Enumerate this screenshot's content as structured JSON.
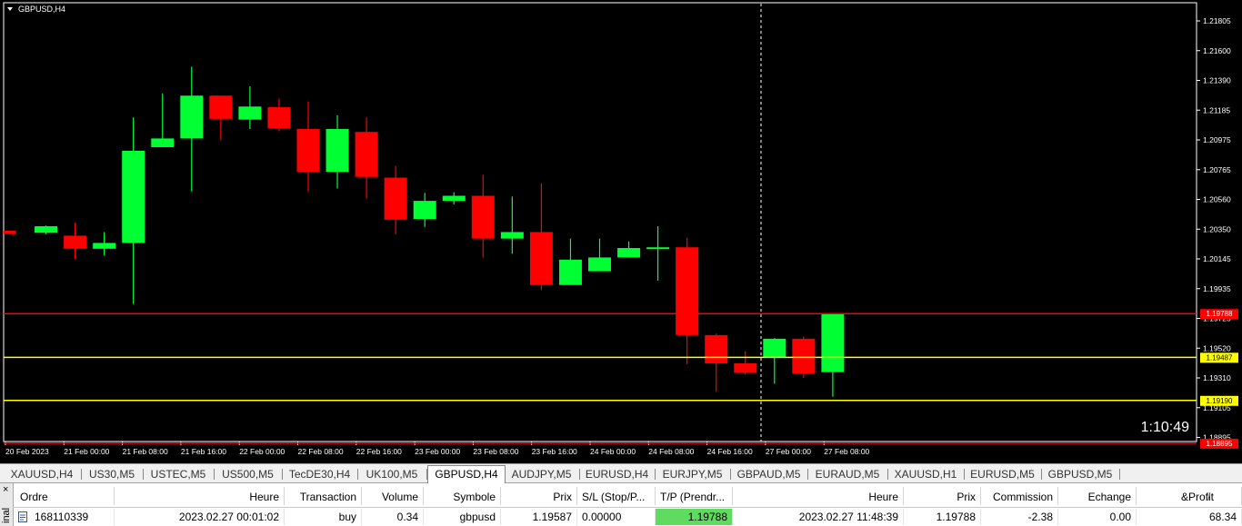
{
  "chart": {
    "title": "GBPUSD,H4",
    "timer": "1:10:49",
    "price_labels": [
      "1.21805",
      "1.21600",
      "1.21390",
      "1.21185",
      "1.20975",
      "1.20765",
      "1.20560",
      "1.20350",
      "1.20145",
      "1.19935",
      "1.19725",
      "1.19520",
      "1.19310",
      "1.19105",
      "1.18895"
    ],
    "time_labels": [
      "20 Feb 2023",
      "21 Feb 00:00",
      "21 Feb 08:00",
      "21 Feb 16:00",
      "22 Feb 00:00",
      "22 Feb 08:00",
      "22 Feb 16:00",
      "23 Feb 00:00",
      "23 Feb 08:00",
      "23 Feb 16:00",
      "24 Feb 00:00",
      "24 Feb 08:00",
      "24 Feb 16:00",
      "27 Feb 00:00",
      "27 Feb 08:00"
    ],
    "level_lines": [
      {
        "price": 1.19788,
        "label": "1.19788",
        "color": "#ff0000",
        "label_bg": "#ff0000",
        "label_color": "#ffffff"
      },
      {
        "price": 1.19487,
        "label": "1.19487",
        "color": "#ffff00",
        "label_bg": "#ffff00",
        "label_color": "#000000"
      },
      {
        "price": 1.1919,
        "label": "1.19190",
        "color": "#ffff00",
        "label_bg": "#ffff00",
        "label_color": "#000000"
      },
      {
        "price": 1.18895,
        "label": "1.18895",
        "color": "#ff0000",
        "label_bg": "#ff0000",
        "label_color": "#ffffff"
      }
    ],
    "colors": {
      "bull": "#00ff33",
      "bear": "#ff0000",
      "wick_bull": "#00ff33",
      "wick_bear": "#ff0000",
      "crosshair": "#ffffff"
    },
    "candles": [
      {
        "o": 1.2036,
        "h": 1.2036,
        "l": 1.2033,
        "c": 1.2034
      },
      {
        "o": 1.20345,
        "h": 1.20395,
        "l": 1.20335,
        "c": 1.2039
      },
      {
        "o": 1.20325,
        "h": 1.20415,
        "l": 1.20165,
        "c": 1.20235
      },
      {
        "o": 1.20235,
        "h": 1.2035,
        "l": 1.2019,
        "c": 1.20275
      },
      {
        "o": 1.20275,
        "h": 1.2114,
        "l": 1.19855,
        "c": 1.2091
      },
      {
        "o": 1.20935,
        "h": 1.21305,
        "l": 1.20935,
        "c": 1.20995
      },
      {
        "o": 1.20995,
        "h": 1.2149,
        "l": 1.2063,
        "c": 1.2129
      },
      {
        "o": 1.2129,
        "h": 1.2129,
        "l": 1.20985,
        "c": 1.2113
      },
      {
        "o": 1.21125,
        "h": 1.21355,
        "l": 1.2106,
        "c": 1.21215
      },
      {
        "o": 1.2121,
        "h": 1.2127,
        "l": 1.21045,
        "c": 1.21065
      },
      {
        "o": 1.2106,
        "h": 1.2125,
        "l": 1.2063,
        "c": 1.20765
      },
      {
        "o": 1.20765,
        "h": 1.21155,
        "l": 1.2065,
        "c": 1.2106
      },
      {
        "o": 1.2104,
        "h": 1.2114,
        "l": 1.2058,
        "c": 1.2073
      },
      {
        "o": 1.20725,
        "h": 1.20805,
        "l": 1.20335,
        "c": 1.20435
      },
      {
        "o": 1.2044,
        "h": 1.2062,
        "l": 1.20385,
        "c": 1.20565
      },
      {
        "o": 1.20565,
        "h": 1.20625,
        "l": 1.2054,
        "c": 1.206
      },
      {
        "o": 1.206,
        "h": 1.20745,
        "l": 1.20175,
        "c": 1.20305
      },
      {
        "o": 1.20305,
        "h": 1.20595,
        "l": 1.202,
        "c": 1.2035
      },
      {
        "o": 1.2035,
        "h": 1.20685,
        "l": 1.1995,
        "c": 1.19985
      },
      {
        "o": 1.19985,
        "h": 1.20305,
        "l": 1.19985,
        "c": 1.2016
      },
      {
        "o": 1.2008,
        "h": 1.20305,
        "l": 1.2008,
        "c": 1.20175
      },
      {
        "o": 1.20175,
        "h": 1.20285,
        "l": 1.20175,
        "c": 1.2024
      },
      {
        "o": 1.2024,
        "h": 1.2039,
        "l": 1.20015,
        "c": 1.20245
      },
      {
        "o": 1.20245,
        "h": 1.2031,
        "l": 1.1944,
        "c": 1.1964
      },
      {
        "o": 1.1964,
        "h": 1.1965,
        "l": 1.1925,
        "c": 1.19445
      },
      {
        "o": 1.19445,
        "h": 1.1953,
        "l": 1.1937,
        "c": 1.1938
      },
      {
        "o": 1.19485,
        "h": 1.1962,
        "l": 1.19305,
        "c": 1.19615
      },
      {
        "o": 1.19615,
        "h": 1.1963,
        "l": 1.19345,
        "c": 1.19375
      },
      {
        "o": 1.19385,
        "h": 1.19788,
        "l": 1.19215,
        "c": 1.19788
      }
    ]
  },
  "tabs": [
    "XAUUSD,H4",
    "US30,M5",
    "USTEC,M5",
    "US500,M5",
    "TecDE30,H4",
    "UK100,M5",
    "GBPUSD,H4",
    "AUDJPY,M5",
    "EURUSD,H4",
    "EURJPY,M5",
    "GBPAUD,M5",
    "EURAUD,M5",
    "XAUUSD,H1",
    "EURUSD,M5",
    "GBPUSD,M5"
  ],
  "active_tab": "GBPUSD,H4",
  "terminal": {
    "side_label": "inal",
    "close_symbol": "×",
    "headers": [
      "Ordre",
      "Heure",
      "Transaction",
      "Volume",
      "Symbole",
      "Prix",
      "S/L (Stop/P...",
      "T/P (Prendr...",
      "Heure",
      "Prix",
      "Commission",
      "Echange",
      "&Profit"
    ],
    "row": [
      "168110339",
      "2023.02.27 00:01:02",
      "buy",
      "0.34",
      "gbpusd",
      "1.19587",
      "0.00000",
      "1.19788",
      "2023.02.27 11:48:39",
      "1.19788",
      "-2.38",
      "0.00",
      "68.34"
    ],
    "profit_marker": "/"
  }
}
